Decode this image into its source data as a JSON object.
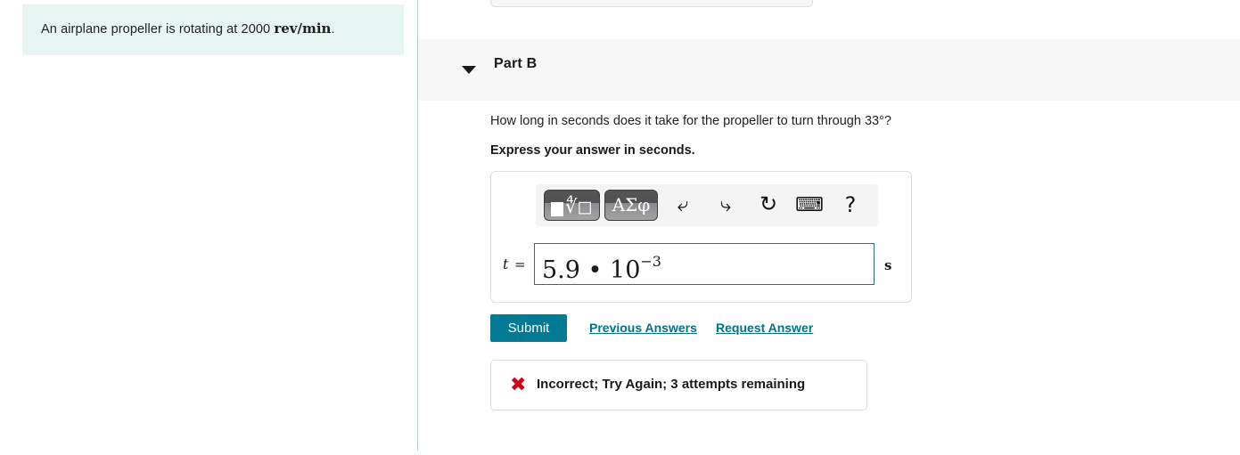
{
  "left_panel": {
    "problem_statement_prefix": "An airplane propeller is rotating at 2000 ",
    "problem_statement_unit": "rev/min",
    "problem_statement_suffix": "."
  },
  "right_panel": {
    "part": {
      "title": "Part B",
      "toggle_icon": "caret-down-icon",
      "expanded": "true"
    },
    "question": "How long in seconds does it take for the propeller to turn through 33°?",
    "instruction": "Express your answer in seconds.",
    "answer_entry": {
      "toolbar": {
        "template_button_label": "■√□",
        "template_button_name": "math-template-icon",
        "greek_button_label": "ΑΣφ",
        "undo_icon": "↶",
        "redo_icon": "↷",
        "reset_icon": "⟳",
        "keyboard_icon": "⌨",
        "help_icon": "?"
      },
      "variable": "t",
      "equals": "=",
      "value_mantissa": "5.9 • 10",
      "value_exponent": "−3",
      "unit": "s"
    },
    "actions": {
      "submit_label": "Submit",
      "previous_answers_label": "Previous Answers",
      "request_answer_label": "Request Answer"
    },
    "feedback": {
      "icon": "✖",
      "message": "Incorrect; Try Again; 3 attempts remaining",
      "status_color": "#d0021b"
    }
  },
  "theme": {
    "accent": "#027a94",
    "link": "#00728c",
    "problem_bg": "#e7f5f2",
    "header_band_bg": "#f7f7f7",
    "input_border": "#2e6d84",
    "divider": "#b9cdd8"
  }
}
